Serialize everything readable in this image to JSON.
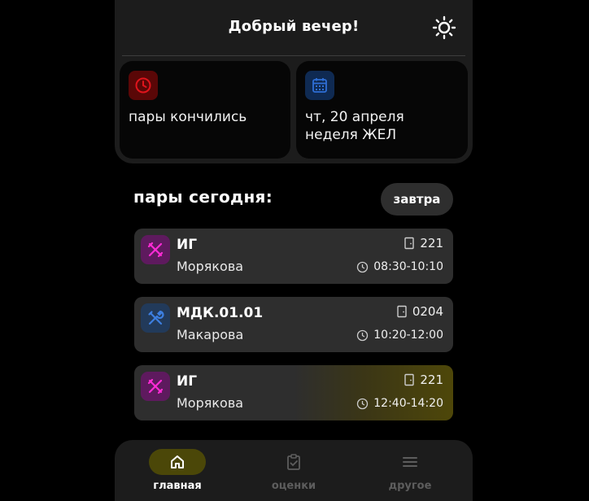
{
  "header": {
    "greeting": "Добрый вечер!",
    "theme_icon": "sun-icon"
  },
  "cards": {
    "status": {
      "icon": "clock-icon",
      "text": "пары кончились",
      "accent": "#e0141c"
    },
    "date": {
      "icon": "calendar-icon",
      "line1": "чт, 20 апреля",
      "line2": "неделя ЖЕЛ",
      "accent": "#2f6fd6"
    }
  },
  "schedule": {
    "title": "пары сегодня:",
    "tomorrow_label": "завтра",
    "lessons": [
      {
        "icon": "ruler-pencil-icon",
        "subject": "ИГ",
        "teacher": "Морякова",
        "room": "221",
        "time": "08:30-10:10",
        "current": false
      },
      {
        "icon": "tools-icon",
        "subject": "МДК.01.01",
        "teacher": "Макарова",
        "room": "0204",
        "time": "10:20-12:00",
        "current": false
      },
      {
        "icon": "ruler-pencil-icon",
        "subject": "ИГ",
        "teacher": "Морякова",
        "room": "221",
        "time": "12:40-14:20",
        "current": true
      }
    ]
  },
  "nav": {
    "items": [
      {
        "icon": "home-icon",
        "label": "главная",
        "active": true
      },
      {
        "icon": "clipboard-check-icon",
        "label": "оценки",
        "active": false
      },
      {
        "icon": "menu-icon",
        "label": "другое",
        "active": false
      }
    ]
  },
  "colors": {
    "background": "#000000",
    "panel": "#1c1c1c",
    "lesson_card": "#2e2e2e",
    "active_pill": "#4b4708",
    "pink_accent": "#ff2bd6",
    "blue_accent": "#3d7fe0"
  }
}
